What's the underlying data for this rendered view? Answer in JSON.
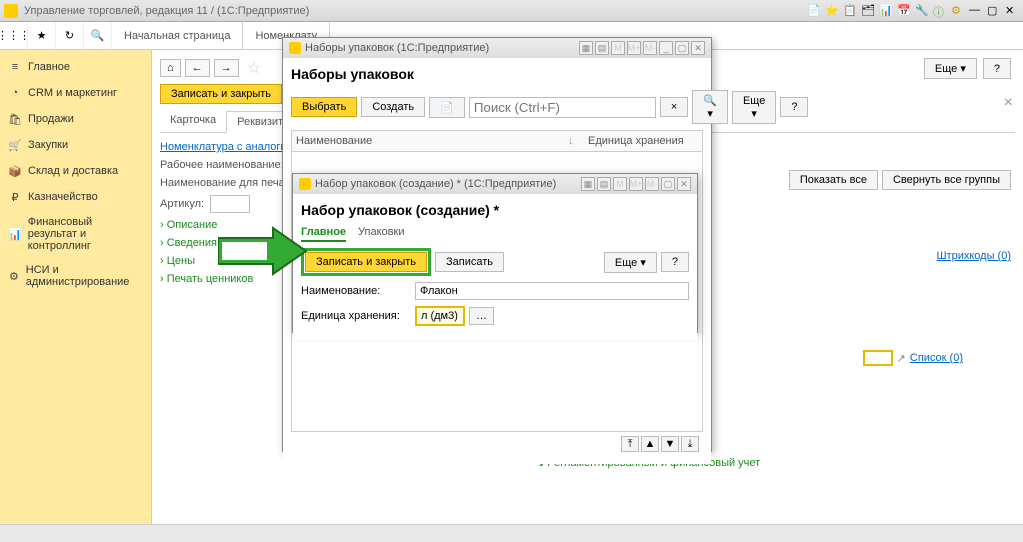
{
  "app": {
    "title": "Управление торговлей, редакция 11 / (1С:Предприятие)"
  },
  "tabs": {
    "home": "Начальная страница",
    "nomen": "Номенклату"
  },
  "sidebar": {
    "items": [
      {
        "label": "Главное"
      },
      {
        "label": "CRM и маркетинг"
      },
      {
        "label": "Продажи"
      },
      {
        "label": "Закупки"
      },
      {
        "label": "Склад и доставка"
      },
      {
        "label": "Казначейство"
      },
      {
        "label": "Финансовый результат и контроллинг"
      },
      {
        "label": "НСИ и администрирование"
      }
    ]
  },
  "content": {
    "save_close": "Записать и закрыть",
    "tab_card": "Карточка",
    "tab_req": "Реквизиты",
    "link_analog": "Номенклатура с аналоги",
    "work_name": "Рабочее наименование:",
    "print_name": "Наименование для печати",
    "article": "Артикул:",
    "desc": "Описание",
    "about": "Сведения о прои",
    "prices": "Цены",
    "price_print": "Печать ценников",
    "more": "Еще",
    "show_all": "Показать все",
    "collapse": "Свернуть все группы",
    "barcodes": "Штрихкоды (0)",
    "list": "Список (0)",
    "footer_acc": "Регламентированный и финансовый учет"
  },
  "modal1": {
    "wintitle": "Наборы упаковок  (1С:Предприятие)",
    "title": "Наборы упаковок",
    "select": "Выбрать",
    "create": "Создать",
    "search_ph": "Поиск (Ctrl+F)",
    "more": "Еще",
    "col1": "Наименование",
    "col2": "Единица хранения"
  },
  "modal2": {
    "wintitle": "Набор упаковок (создание) *  (1С:Предприятие)",
    "title": "Набор упаковок (создание) *",
    "tab_main": "Главное",
    "tab_pack": "Упаковки",
    "save_close": "Записать и закрыть",
    "save": "Записать",
    "more": "Еще",
    "name_lbl": "Наименование:",
    "name_val": "Флакон",
    "unit_lbl": "Единица хранения:",
    "unit_val": "л (дм3)"
  }
}
